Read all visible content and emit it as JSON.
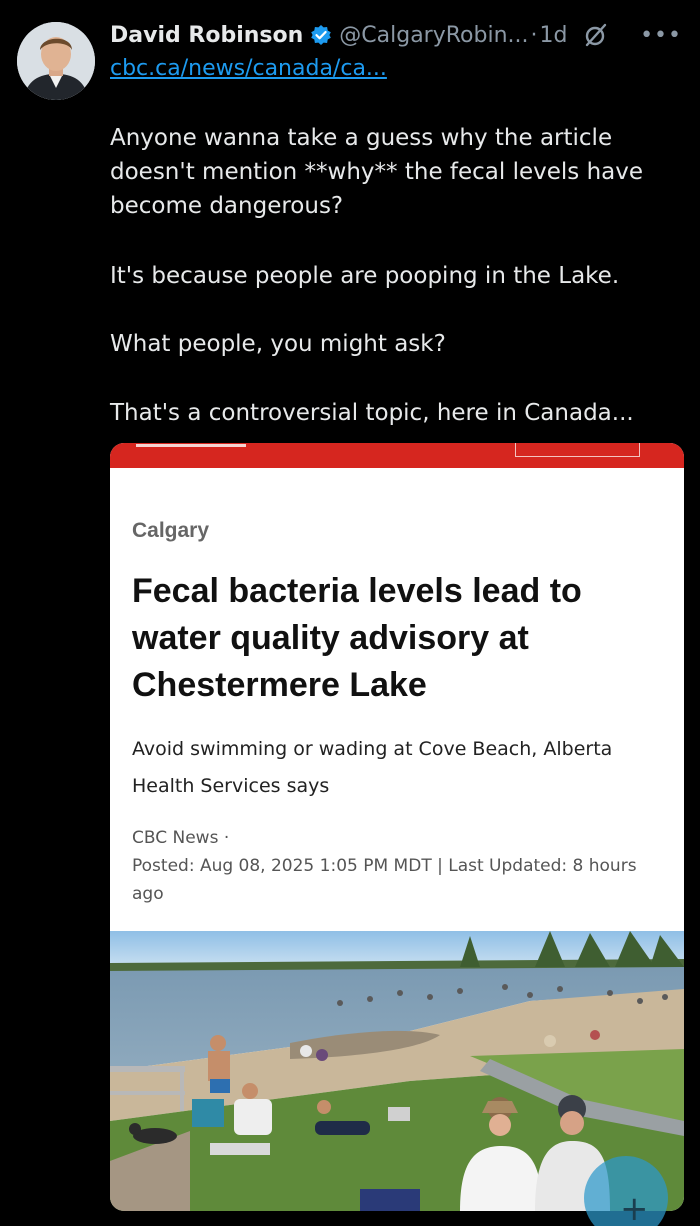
{
  "tweet": {
    "author_name": "David Robinson",
    "handle": "@CalgaryRobin...",
    "separator": "·",
    "timestamp": "1d",
    "link_text": "cbc.ca/news/canada/ca...",
    "paragraphs": [
      "Anyone wanna take a guess why the article doesn't mention **why** the fecal levels have become dangerous?",
      "It's because people are pooping in the Lake.",
      "What people, you might ask?",
      "That's a controversial topic, here in Canada..."
    ],
    "more_label": "•••"
  },
  "article": {
    "kicker": "Calgary",
    "headline": "Fecal bacteria levels lead to water quality advisory at Chestermere Lake",
    "deck": "Avoid swimming or wading at Cove Beach, Alberta Health Services says",
    "source": "CBC News ·",
    "dateline": "Posted: Aug 08, 2025 1:05 PM MDT | Last Updated: 8 hours ago"
  },
  "fab": {
    "label": "+"
  },
  "icons": {
    "verified": "verified-badge-icon",
    "grok": "grok-icon",
    "more": "more-icon"
  },
  "colors": {
    "background": "#000000",
    "link": "#1d9bf0",
    "verified": "#1d9bf0",
    "cbc_red": "#d6261f"
  }
}
